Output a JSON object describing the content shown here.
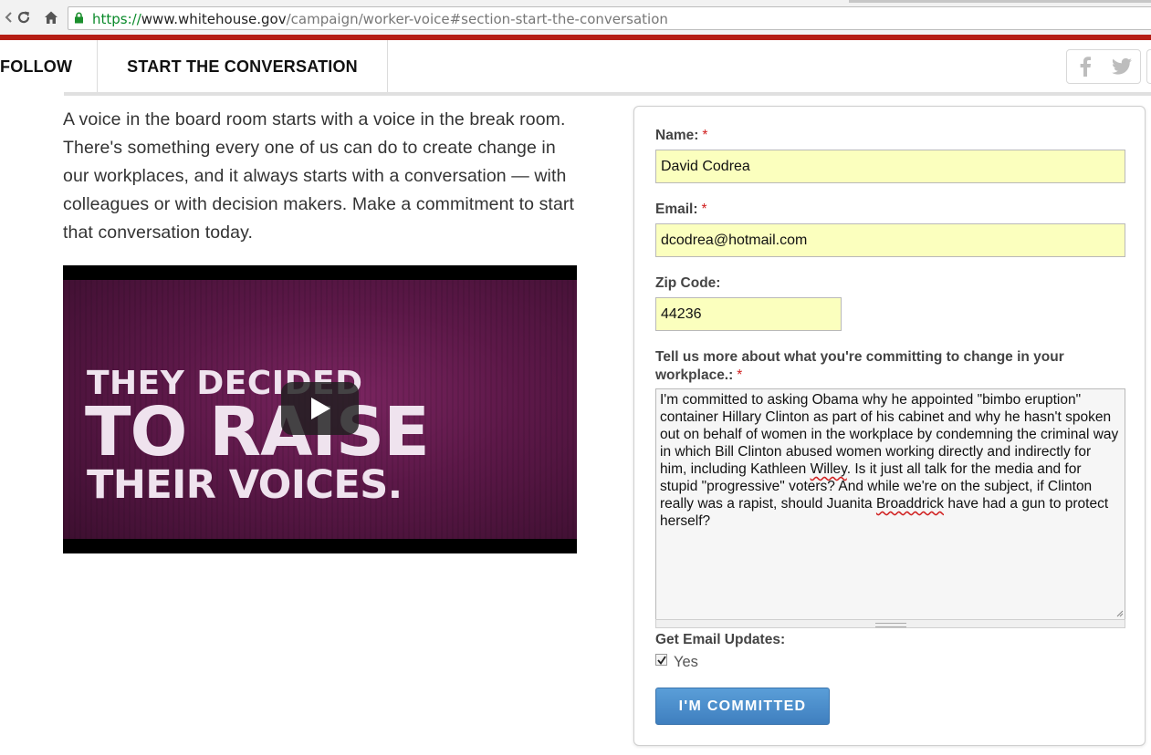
{
  "browser": {
    "url_scheme": "https://",
    "url_host": "www.whitehouse.gov",
    "url_path": "/campaign/worker-voice#section-start-the-conversation"
  },
  "nav": {
    "follow": "FOLLOW",
    "start": "START THE CONVERSATION",
    "social": [
      "facebook-icon",
      "twitter-icon"
    ]
  },
  "intro": "A voice in the board room starts with a voice in the break room. There's something every one of us can do to create change in our workplaces, and it always starts with a conversation — with colleagues or with decision makers. Make a commitment to start that conversation today.",
  "video": {
    "line1": "THEY DECIDED",
    "line2": "TO RAISE",
    "line3": "THEIR VOICES."
  },
  "form": {
    "name_label": "Name:",
    "name_value": "David Codrea",
    "email_label": "Email:",
    "email_value": "dcodrea@hotmail.com",
    "zip_label": "Zip Code:",
    "zip_value": "44236",
    "commit_label_line1": "Tell us more about what you're committing to change in your",
    "commit_label_line2": "workplace.:",
    "commit_text": {
      "part1": "I'm committed to asking Obama why he appointed \"bimbo eruption\" container Hillary Clinton as part of his cabinet and why he hasn't spoken out on behalf of women in the workplace by condemning the criminal way in which Bill Clinton abused women working directly and indirectly for him, including Kathleen ",
      "word1": "Willey",
      "part2": ". Is it just all talk for the media and for stupid \"progressive\" voters? And while we're on the subject, if Clinton really was a rapist, should Juanita ",
      "word2": "Broaddrick",
      "part3": " have had a gun to protect herself?"
    },
    "required_mark": "*",
    "updates_label": "Get Email Updates:",
    "updates_option": "Yes",
    "updates_checked": true,
    "submit_label": "I'M COMMITTED"
  },
  "colors": {
    "red_bar": "#b51d14",
    "field_bg": "#fbffbe",
    "button": "#4a8fcf"
  }
}
